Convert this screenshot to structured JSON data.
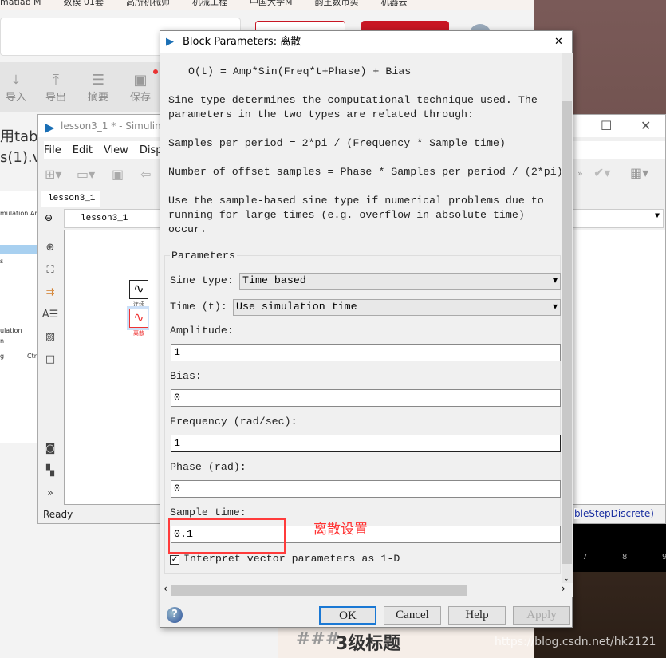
{
  "browser": {
    "bookmarks": [
      "matlab M",
      "数模 01套",
      "高所机械师",
      "机械工程",
      "中国大学M",
      "韵王数币实",
      "机器云"
    ]
  },
  "web": {
    "toolbar": [
      {
        "icon": "import-icon",
        "label": "导入"
      },
      {
        "icon": "export-icon",
        "label": "导出"
      },
      {
        "icon": "summary-icon",
        "label": "摘要"
      },
      {
        "icon": "save-icon",
        "label": "保存"
      }
    ],
    "text_lines": [
      "用tab",
      "s(1).va"
    ],
    "left_panel": [
      "mulation",
      "Ar",
      "s",
      "ulation",
      "n",
      "g",
      "Ctrl"
    ],
    "heading_marker": "###",
    "heading": "3级标题",
    "watermark": "https://blog.csdn.net/hk2121"
  },
  "simulink": {
    "title": "lesson3_1 * - Simulink",
    "menu": [
      "File",
      "Edit",
      "View",
      "Disp"
    ],
    "tab": "lesson3_1",
    "breadcrumb": "lesson3_1",
    "blocks": [
      {
        "label": "连续"
      },
      {
        "label": "离散"
      }
    ],
    "status": "Ready",
    "solver_text": "bleStepDiscrete)",
    "scope_ticks": [
      "7",
      "8",
      "9"
    ]
  },
  "dialog": {
    "title": "Block Parameters: 离散",
    "description": [
      "O(t) = Amp*Sin(Freq*t+Phase) + Bias",
      "Sine type determines the computational technique used. The",
      "parameters in the two types are related through:",
      "Samples per period = 2*pi / (Frequency * Sample time)",
      "Number of offset samples = Phase * Samples per period / (2*pi)",
      "Use the sample-based sine type if numerical problems due to",
      "running for large times (e.g. overflow in absolute time)",
      "occur."
    ],
    "group": "Parameters",
    "sine_type": {
      "label": "Sine type:",
      "value": "Time based"
    },
    "time": {
      "label": "Time (t):",
      "value": "Use simulation time"
    },
    "amplitude": {
      "label": "Amplitude:",
      "value": "1"
    },
    "bias": {
      "label": "Bias:",
      "value": "0"
    },
    "frequency": {
      "label": "Frequency (rad/sec):",
      "value": "1"
    },
    "phase": {
      "label": "Phase (rad):",
      "value": "0"
    },
    "sample_time": {
      "label": "Sample time:",
      "value": "0.1"
    },
    "interpret": {
      "label": "Interpret vector parameters as 1-D",
      "checked": true
    },
    "annotation": "离散设置",
    "annotation_color": "#ff3333",
    "buttons": {
      "ok": "OK",
      "cancel": "Cancel",
      "help": "Help",
      "apply": "Apply"
    }
  }
}
